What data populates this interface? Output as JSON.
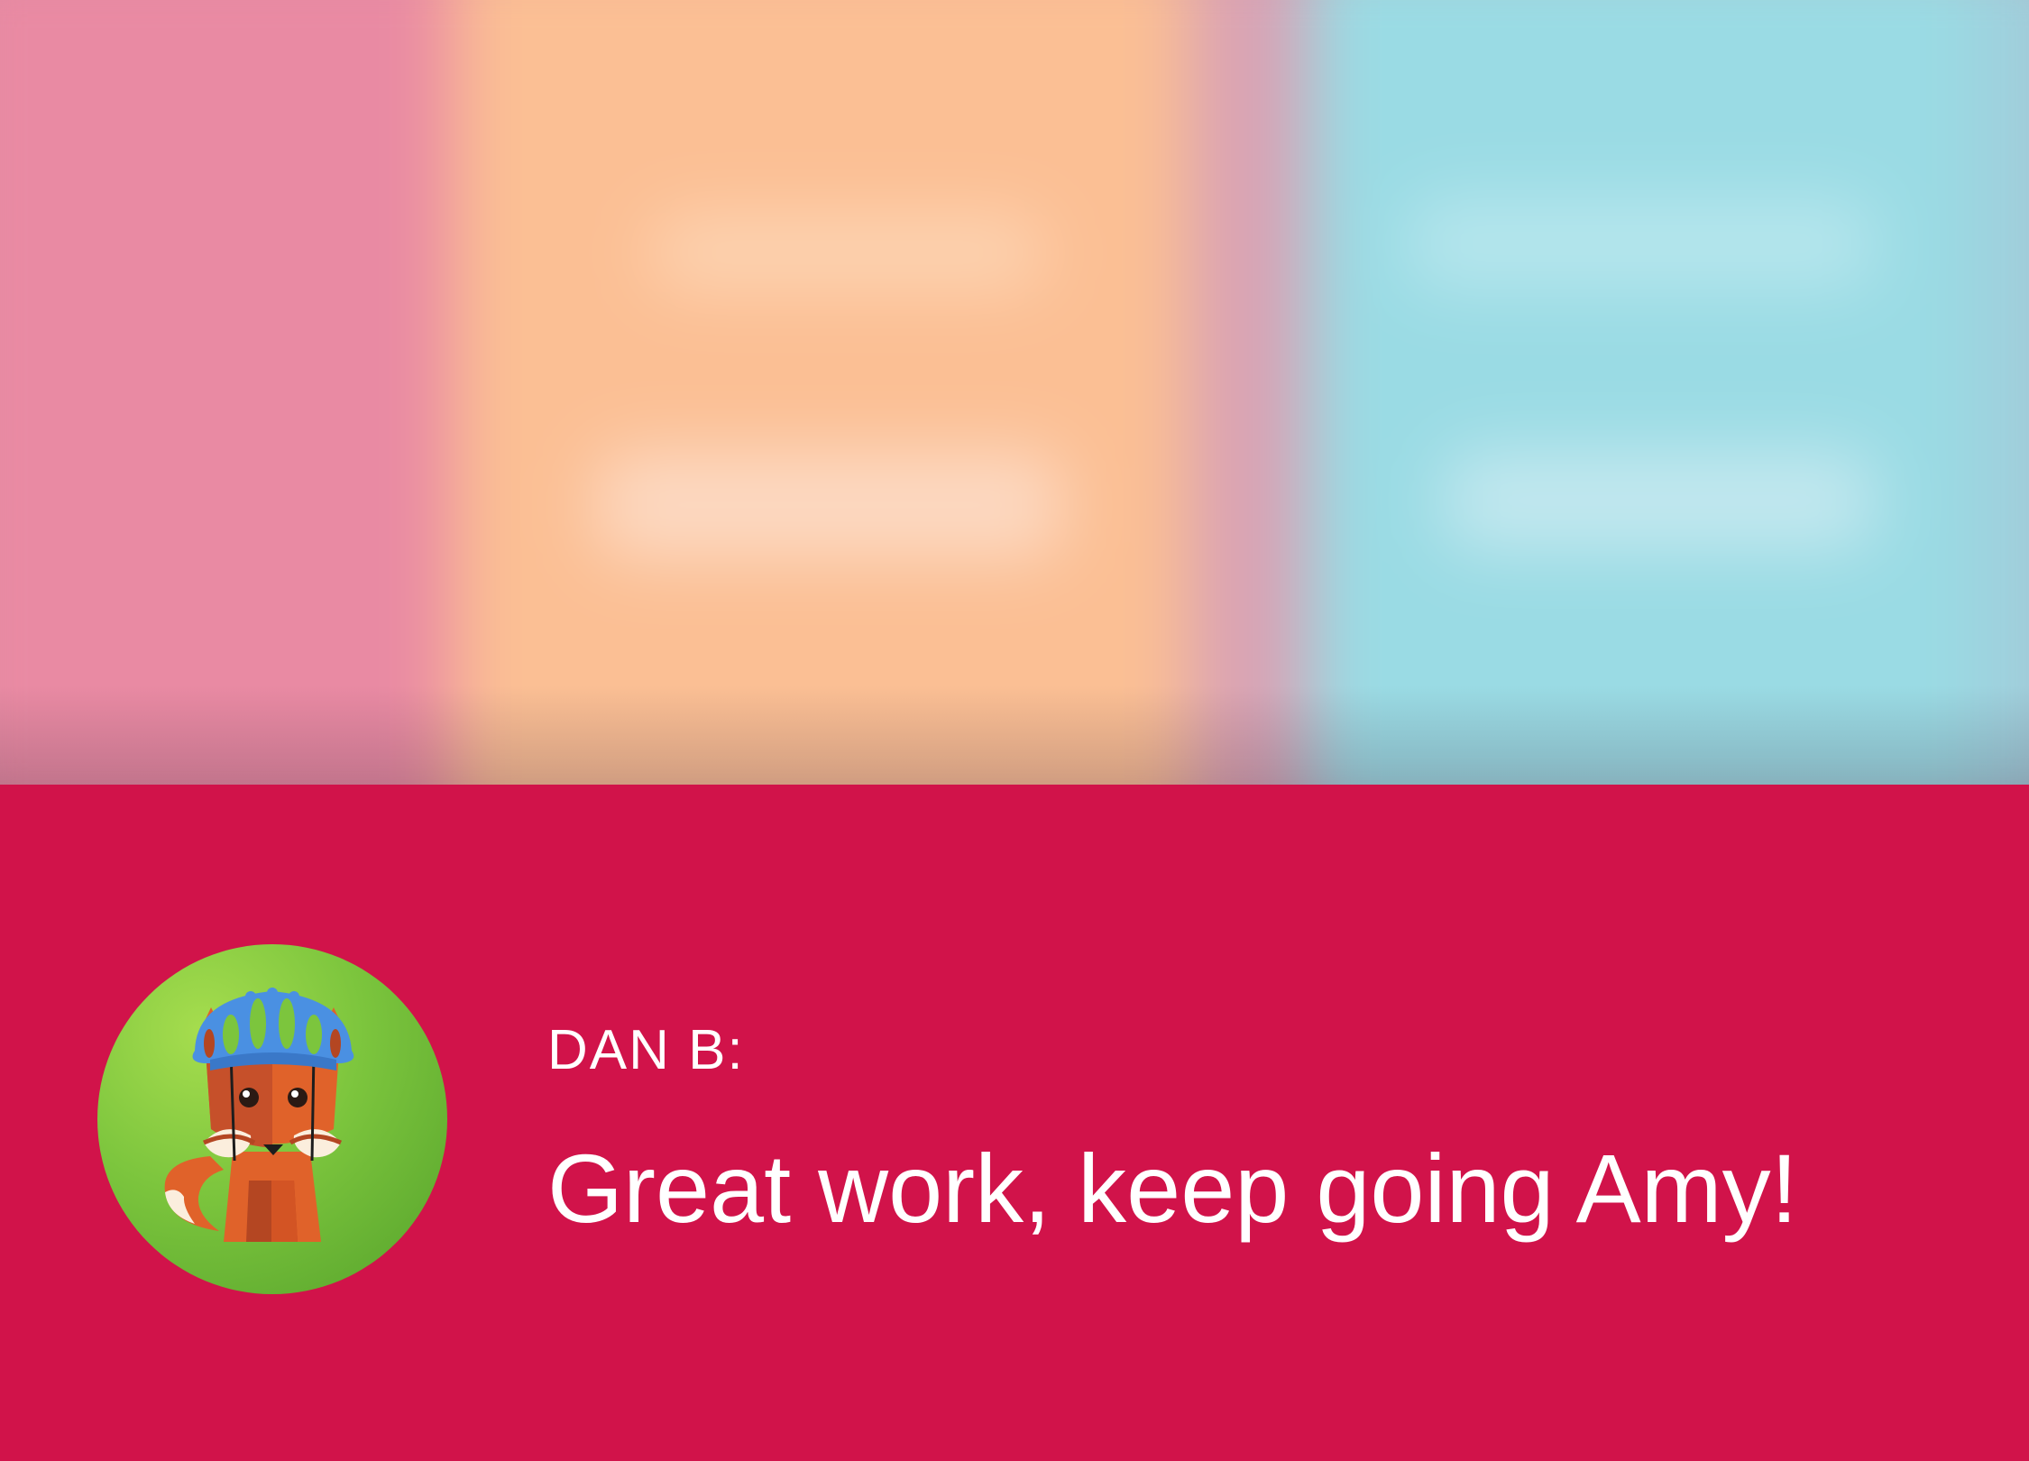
{
  "message": {
    "sender": "DAN B:",
    "text": "Great work, keep going Amy!"
  },
  "avatar": {
    "icon": "fox-cyclist-icon"
  },
  "colors": {
    "panel_background": "#d1134a",
    "text": "#ffffff",
    "avatar_green": "#7cc53d",
    "helmet_blue": "#4a90e2",
    "fox_orange": "#e0622a",
    "backdrop_pink": "#e98aa3",
    "backdrop_orange": "#fbbf94",
    "backdrop_cyan": "#9adbe4"
  }
}
